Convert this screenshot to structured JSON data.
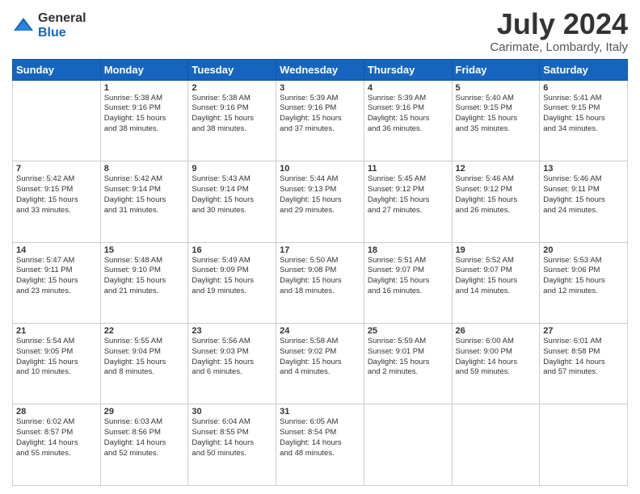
{
  "logo": {
    "general": "General",
    "blue": "Blue"
  },
  "title": "July 2024",
  "subtitle": "Carimate, Lombardy, Italy",
  "days_header": [
    "Sunday",
    "Monday",
    "Tuesday",
    "Wednesday",
    "Thursday",
    "Friday",
    "Saturday"
  ],
  "weeks": [
    [
      {
        "day": "",
        "info": ""
      },
      {
        "day": "1",
        "info": "Sunrise: 5:38 AM\nSunset: 9:16 PM\nDaylight: 15 hours\nand 38 minutes."
      },
      {
        "day": "2",
        "info": "Sunrise: 5:38 AM\nSunset: 9:16 PM\nDaylight: 15 hours\nand 38 minutes."
      },
      {
        "day": "3",
        "info": "Sunrise: 5:39 AM\nSunset: 9:16 PM\nDaylight: 15 hours\nand 37 minutes."
      },
      {
        "day": "4",
        "info": "Sunrise: 5:39 AM\nSunset: 9:16 PM\nDaylight: 15 hours\nand 36 minutes."
      },
      {
        "day": "5",
        "info": "Sunrise: 5:40 AM\nSunset: 9:15 PM\nDaylight: 15 hours\nand 35 minutes."
      },
      {
        "day": "6",
        "info": "Sunrise: 5:41 AM\nSunset: 9:15 PM\nDaylight: 15 hours\nand 34 minutes."
      }
    ],
    [
      {
        "day": "7",
        "info": "Sunrise: 5:42 AM\nSunset: 9:15 PM\nDaylight: 15 hours\nand 33 minutes."
      },
      {
        "day": "8",
        "info": "Sunrise: 5:42 AM\nSunset: 9:14 PM\nDaylight: 15 hours\nand 31 minutes."
      },
      {
        "day": "9",
        "info": "Sunrise: 5:43 AM\nSunset: 9:14 PM\nDaylight: 15 hours\nand 30 minutes."
      },
      {
        "day": "10",
        "info": "Sunrise: 5:44 AM\nSunset: 9:13 PM\nDaylight: 15 hours\nand 29 minutes."
      },
      {
        "day": "11",
        "info": "Sunrise: 5:45 AM\nSunset: 9:12 PM\nDaylight: 15 hours\nand 27 minutes."
      },
      {
        "day": "12",
        "info": "Sunrise: 5:46 AM\nSunset: 9:12 PM\nDaylight: 15 hours\nand 26 minutes."
      },
      {
        "day": "13",
        "info": "Sunrise: 5:46 AM\nSunset: 9:11 PM\nDaylight: 15 hours\nand 24 minutes."
      }
    ],
    [
      {
        "day": "14",
        "info": "Sunrise: 5:47 AM\nSunset: 9:11 PM\nDaylight: 15 hours\nand 23 minutes."
      },
      {
        "day": "15",
        "info": "Sunrise: 5:48 AM\nSunset: 9:10 PM\nDaylight: 15 hours\nand 21 minutes."
      },
      {
        "day": "16",
        "info": "Sunrise: 5:49 AM\nSunset: 9:09 PM\nDaylight: 15 hours\nand 19 minutes."
      },
      {
        "day": "17",
        "info": "Sunrise: 5:50 AM\nSunset: 9:08 PM\nDaylight: 15 hours\nand 18 minutes."
      },
      {
        "day": "18",
        "info": "Sunrise: 5:51 AM\nSunset: 9:07 PM\nDaylight: 15 hours\nand 16 minutes."
      },
      {
        "day": "19",
        "info": "Sunrise: 5:52 AM\nSunset: 9:07 PM\nDaylight: 15 hours\nand 14 minutes."
      },
      {
        "day": "20",
        "info": "Sunrise: 5:53 AM\nSunset: 9:06 PM\nDaylight: 15 hours\nand 12 minutes."
      }
    ],
    [
      {
        "day": "21",
        "info": "Sunrise: 5:54 AM\nSunset: 9:05 PM\nDaylight: 15 hours\nand 10 minutes."
      },
      {
        "day": "22",
        "info": "Sunrise: 5:55 AM\nSunset: 9:04 PM\nDaylight: 15 hours\nand 8 minutes."
      },
      {
        "day": "23",
        "info": "Sunrise: 5:56 AM\nSunset: 9:03 PM\nDaylight: 15 hours\nand 6 minutes."
      },
      {
        "day": "24",
        "info": "Sunrise: 5:58 AM\nSunset: 9:02 PM\nDaylight: 15 hours\nand 4 minutes."
      },
      {
        "day": "25",
        "info": "Sunrise: 5:59 AM\nSunset: 9:01 PM\nDaylight: 15 hours\nand 2 minutes."
      },
      {
        "day": "26",
        "info": "Sunrise: 6:00 AM\nSunset: 9:00 PM\nDaylight: 14 hours\nand 59 minutes."
      },
      {
        "day": "27",
        "info": "Sunrise: 6:01 AM\nSunset: 8:58 PM\nDaylight: 14 hours\nand 57 minutes."
      }
    ],
    [
      {
        "day": "28",
        "info": "Sunrise: 6:02 AM\nSunset: 8:57 PM\nDaylight: 14 hours\nand 55 minutes."
      },
      {
        "day": "29",
        "info": "Sunrise: 6:03 AM\nSunset: 8:56 PM\nDaylight: 14 hours\nand 52 minutes."
      },
      {
        "day": "30",
        "info": "Sunrise: 6:04 AM\nSunset: 8:55 PM\nDaylight: 14 hours\nand 50 minutes."
      },
      {
        "day": "31",
        "info": "Sunrise: 6:05 AM\nSunset: 8:54 PM\nDaylight: 14 hours\nand 48 minutes."
      },
      {
        "day": "",
        "info": ""
      },
      {
        "day": "",
        "info": ""
      },
      {
        "day": "",
        "info": ""
      }
    ]
  ]
}
